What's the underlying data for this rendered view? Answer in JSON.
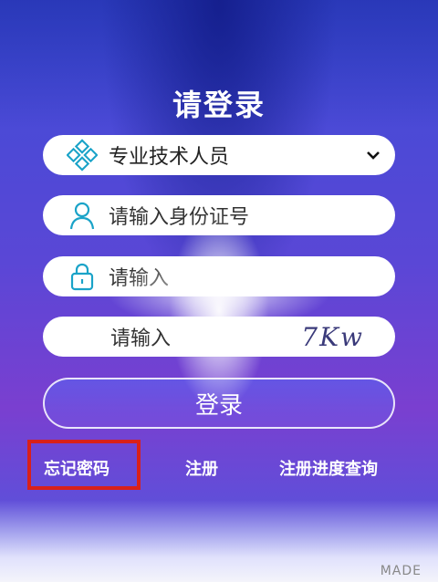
{
  "title": "请登录",
  "user_type": {
    "selected": "专业技术人员"
  },
  "id_field": {
    "placeholder": "请输入身份证号"
  },
  "password_field": {
    "placeholder": "请输入"
  },
  "captcha_field": {
    "placeholder": "请输入",
    "captcha_text": "7Kw"
  },
  "login_button": "登录",
  "links": {
    "forgot_password": "忘记密码",
    "register": "注册",
    "register_progress": "注册进度查询"
  },
  "watermark": "MADE",
  "colors": {
    "highlight": "#d9201a",
    "icon": "#1aa3c8"
  }
}
